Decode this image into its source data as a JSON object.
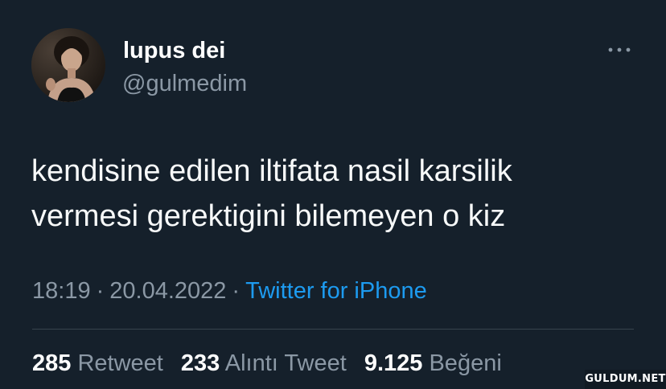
{
  "user": {
    "display_name": "lupus dei",
    "handle": "@gulmedim",
    "avatar_icon": "profile-photo"
  },
  "more_icon": "more-horizontal-icon",
  "tweet": {
    "text_lines": [
      "kendisine edilen iltifata nasil karsilik",
      "vermesi gerektigini bilemeyen o kiz"
    ],
    "time": "18:19",
    "separator": "·",
    "date": "20.04.2022",
    "source": "Twitter for iPhone"
  },
  "stats": {
    "retweets_count": "285",
    "retweets_label": "Retweet",
    "quotes_count": "233",
    "quotes_label": "Alıntı Tweet",
    "likes_count": "9.125",
    "likes_label": "Beğeni"
  },
  "watermark": "GULDUM.NET",
  "colors": {
    "background": "#15202b",
    "primary_text": "#ffffff",
    "secondary_text": "#8b98a5",
    "link": "#1d9bf0",
    "divider": "#38444d"
  }
}
